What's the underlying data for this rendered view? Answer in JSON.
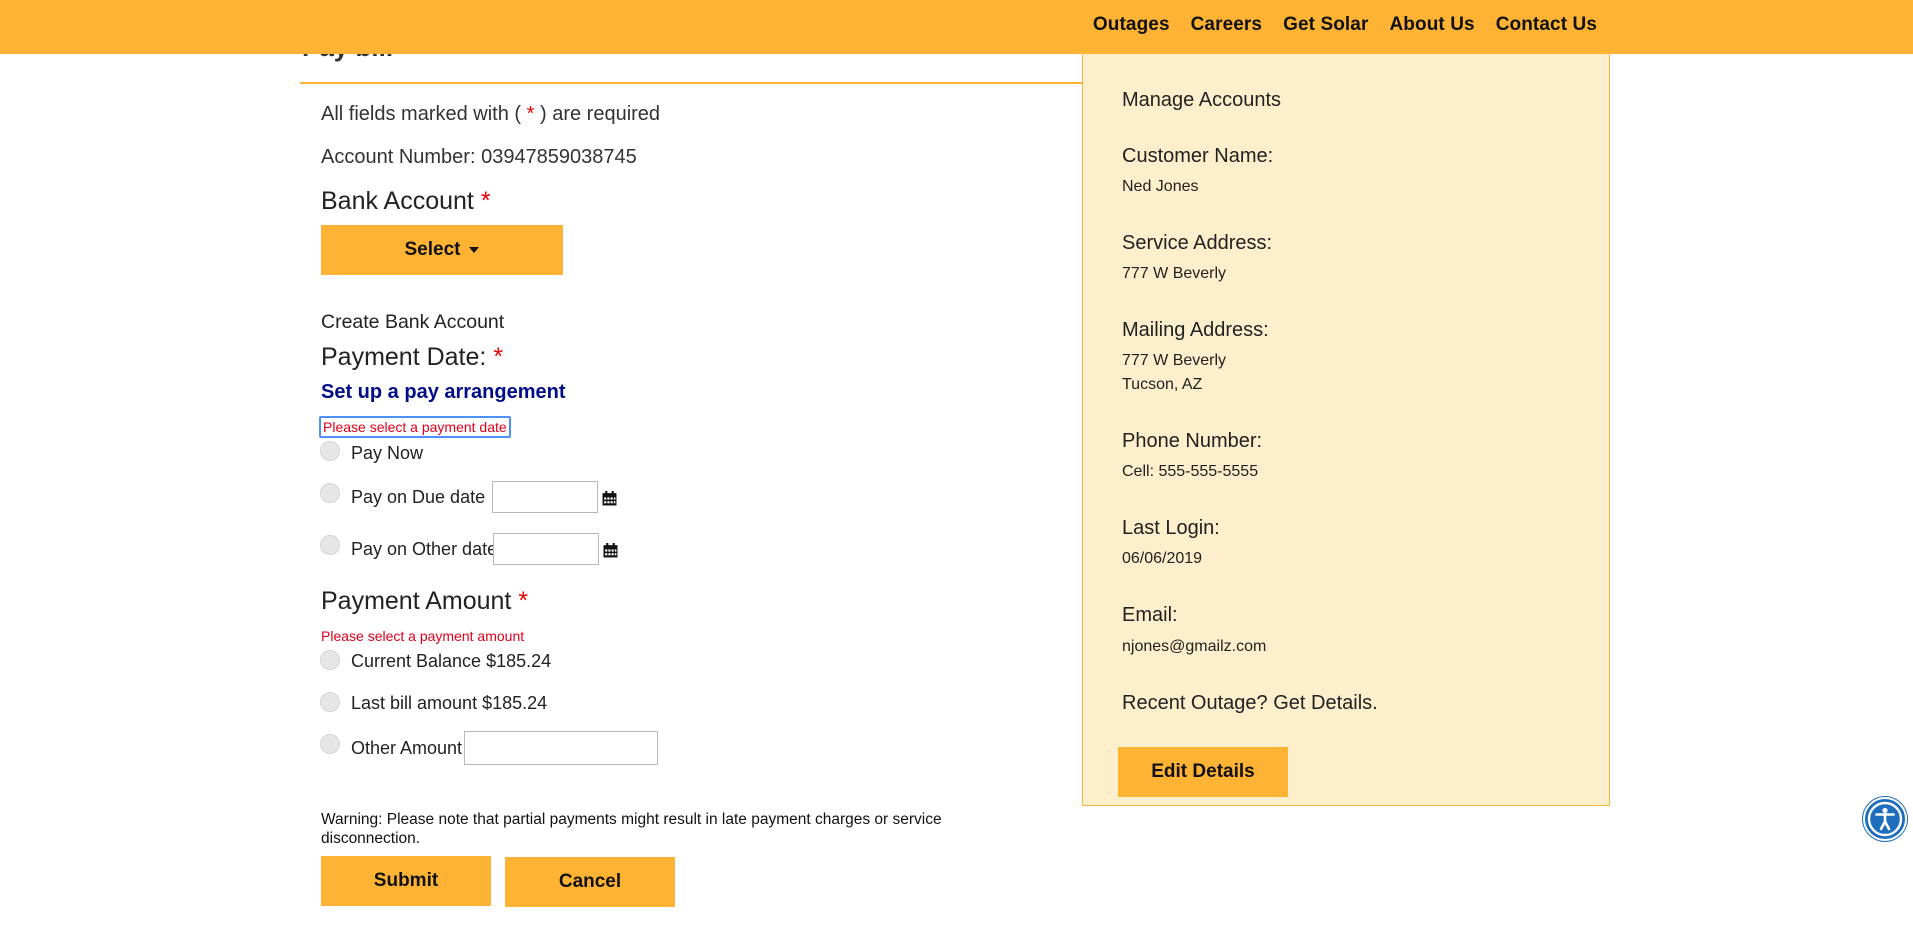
{
  "header": {
    "nav": [
      "Outages",
      "Careers",
      "Get Solar",
      "About Us",
      "Contact Us"
    ]
  },
  "page": {
    "title": "Pay bill"
  },
  "form": {
    "required_note_prefix": "All fields marked with (",
    "required_note_star": "*",
    "required_note_suffix": ") are required",
    "account_number_line": "Account Number: 03947859038745",
    "bank_account_heading": "Bank Account",
    "required_star": "*",
    "select_label": "Select",
    "create_bank_account": "Create Bank Account",
    "payment_date_heading": "Payment Date:",
    "pay_arrangement_link": "Set up a pay arrangement",
    "payment_date_error": "Please select a payment date",
    "date_options": [
      "Pay Now",
      "Pay on Due date",
      "Pay on Other date"
    ],
    "payment_amount_heading": "Payment Amount",
    "payment_amount_error": "Please select a payment amount",
    "amount_options": [
      "Current Balance $185.24",
      "Last bill amount $185.24",
      "Other Amount"
    ],
    "warning": "Warning: Please note that partial payments might result in late payment charges or service disconnection.",
    "submit_label": "Submit",
    "cancel_label": "Cancel"
  },
  "sidebar": {
    "title": "Manage Accounts",
    "customer_name_label": "Customer Name:",
    "customer_name": "Ned Jones",
    "service_address_label": "Service Address:",
    "service_address": "777 W Beverly",
    "mailing_address_label": "Mailing Address:",
    "mailing_address_line1": "777 W Beverly",
    "mailing_address_line2": "Tucson, AZ",
    "phone_label": "Phone Number:",
    "phone": "Cell: 555-555-5555",
    "last_login_label": "Last Login:",
    "last_login": "06/06/2019",
    "email_label": "Email:",
    "email": "njones@gmailz.com",
    "outage_link": "Recent Outage? Get Details.",
    "edit_label": "Edit Details"
  },
  "colors": {
    "brand_yellow": "#feb334",
    "sidebar_bg": "#fdeecc",
    "link_blue": "#000d86",
    "error_red": "#e0001a",
    "a11y_blue": "#1e6ebd"
  },
  "icons": [
    "calendar-icon",
    "accessibility-icon"
  ]
}
